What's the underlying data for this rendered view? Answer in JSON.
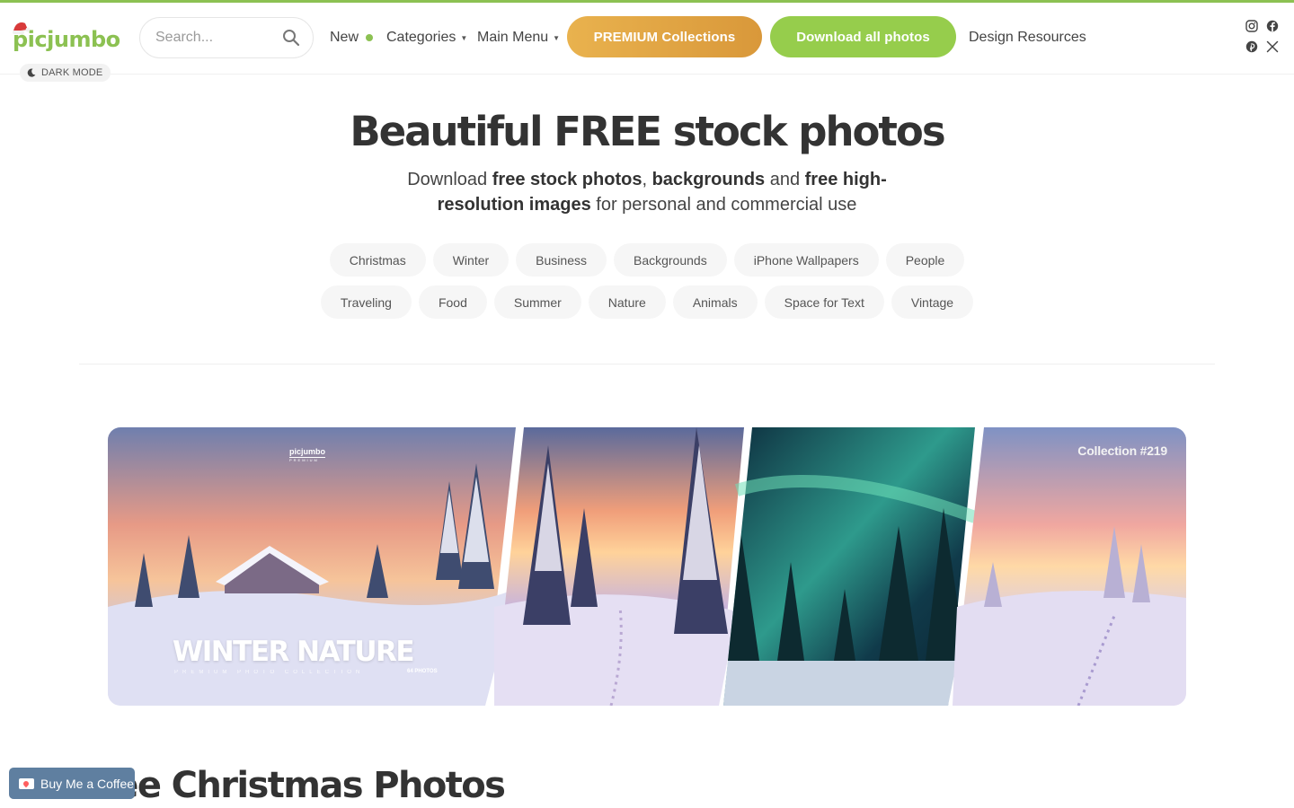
{
  "header": {
    "logo": {
      "part1": "pic",
      "part2": "jumbo"
    },
    "dark_mode_label": "DARK MODE",
    "search": {
      "placeholder": "Search..."
    },
    "nav": {
      "new": "New",
      "categories": "Categories",
      "main_menu": "Main Menu",
      "design_resources": "Design Resources"
    },
    "premium_button": "PREMIUM Collections",
    "download_button": "Download all photos",
    "social_icons": [
      "instagram-icon",
      "facebook-icon",
      "pinterest-icon",
      "x-icon"
    ]
  },
  "hero": {
    "title": "Beautiful FREE stock photos",
    "subtitle_parts": {
      "p1": "Download ",
      "b1": "free stock photos",
      "p2": ", ",
      "b2": "backgrounds",
      "p3": " and ",
      "b3": "free high-resolution images",
      "p4": " for personal and commercial use"
    }
  },
  "tags_row1": [
    "Christmas",
    "Winter",
    "Business",
    "Backgrounds",
    "iPhone Wallpapers",
    "People"
  ],
  "tags_row2": [
    "Traveling",
    "Food",
    "Summer",
    "Nature",
    "Animals",
    "Space for Text",
    "Vintage"
  ],
  "banner": {
    "logo": "picjumbo",
    "logo_sub": "PREMIUM",
    "title": "WINTER NATURE",
    "subtitle": "PREMIUM PHOTO COLLECTION",
    "count": "64 PHOTOS",
    "collection_label": "Collection #219"
  },
  "section": {
    "title": "Free Christmas Photos"
  },
  "bmc": {
    "label": "Buy Me a Coffee"
  },
  "colors": {
    "brand_green": "#8cc152",
    "premium_orange": "#dfa543",
    "download_green": "#96cd4c",
    "bmc_blue": "#5f7fa0"
  }
}
